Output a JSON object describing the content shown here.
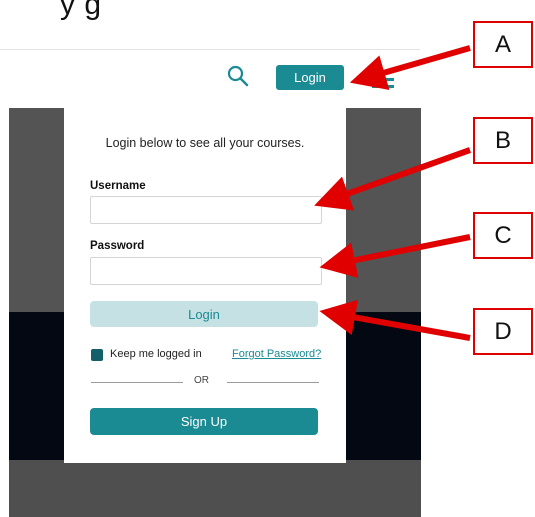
{
  "header": {
    "title_fragment": "y                          g",
    "login_label": "Login"
  },
  "login_card": {
    "subtitle": "Login below to see all your courses.",
    "username_label": "Username",
    "username_value": "",
    "password_label": "Password",
    "password_value": "",
    "login_label": "Login",
    "keep_logged_in_label": "Keep me logged in",
    "keep_logged_in_checked": true,
    "forgot_password_label": "Forgot Password?",
    "or_label": "OR",
    "signup_label": "Sign Up"
  },
  "callouts": [
    "A",
    "B",
    "C",
    "D"
  ],
  "colors": {
    "accent": "#1a8a93",
    "login_disabled_bg": "#c6e1e4",
    "arrow": "#e00000",
    "overlay_dark": "#545454",
    "overlay_black": "#040812"
  },
  "icons": {
    "search": "search-icon",
    "menu": "hamburger-menu-icon"
  }
}
